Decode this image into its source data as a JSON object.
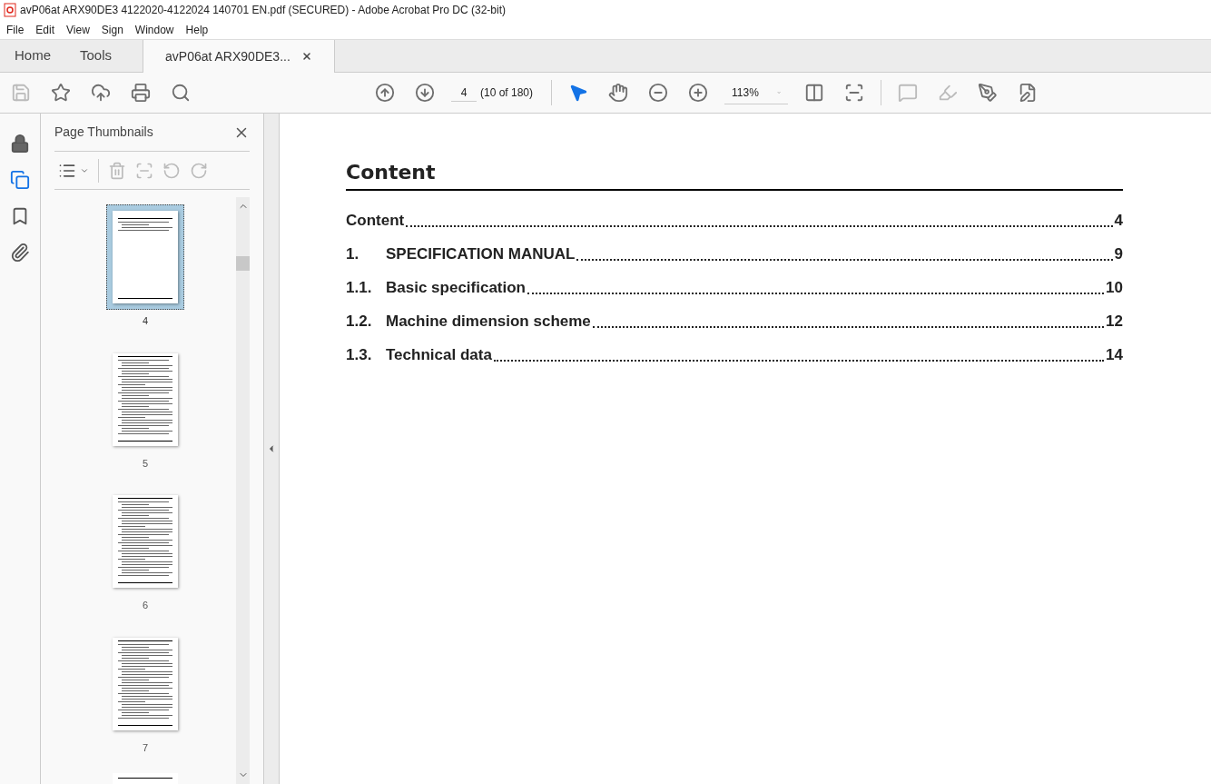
{
  "window": {
    "title": "avP06at ARX90DE3 4122020-4122024 140701 EN.pdf (SECURED) - Adobe Acrobat Pro DC (32-bit)"
  },
  "menu": [
    "File",
    "Edit",
    "View",
    "Sign",
    "Window",
    "Help"
  ],
  "tabs": [
    {
      "label": "Home",
      "selected": false,
      "kind": "nav"
    },
    {
      "label": "Tools",
      "selected": false,
      "kind": "nav"
    },
    {
      "label": "avP06at ARX90DE3...",
      "selected": true,
      "kind": "document"
    }
  ],
  "toolbar": {
    "page": "4",
    "page_count": "(10 of 180)",
    "zoom": "113%"
  },
  "sidebar": {
    "title": "Page Thumbnails",
    "thumbnails": [
      {
        "label": "4",
        "selected": true
      },
      {
        "label": "5",
        "selected": false
      },
      {
        "label": "6",
        "selected": false
      },
      {
        "label": "7",
        "selected": false
      }
    ]
  },
  "document": {
    "heading": "Content",
    "entries": [
      {
        "title": "Content",
        "page": "4"
      },
      {
        "number": "1.",
        "title": "SPECIFICATION MANUAL",
        "page": "9"
      },
      {
        "number": "1.1.",
        "title": "Basic specification",
        "page": "10"
      },
      {
        "number": "1.2.",
        "title": "Machine dimension scheme",
        "page": "12"
      },
      {
        "number": "1.3.",
        "title": "Technical data",
        "page": "14"
      }
    ]
  }
}
